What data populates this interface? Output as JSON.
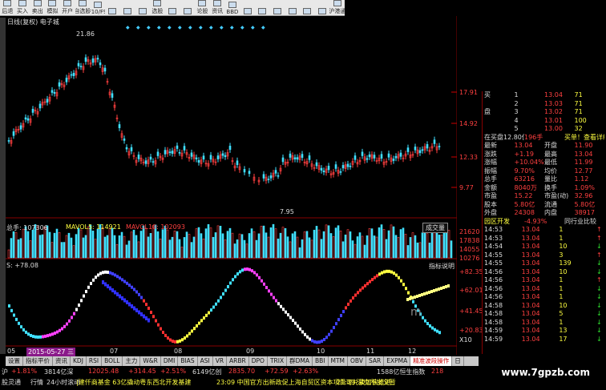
{
  "toolbar": [
    "后退",
    "买入",
    "卖出",
    "模拟",
    "开户",
    "自选股",
    "F10/F9",
    "",
    "",
    "",
    "选股",
    "",
    "",
    "论股",
    "资讯",
    "BBD",
    "",
    "",
    "",
    "",
    "",
    "",
    "沪港通"
  ],
  "chart_header": {
    "title": "日线(复权) 电子城"
  },
  "price_labels": {
    "high_mark": "21.86",
    "low_mark": "7.95",
    "ticks": [
      "17.91",
      "14.92",
      "12.33",
      "9.77"
    ]
  },
  "volume": {
    "label": "总手: 107306",
    "mavol5": "MAVOL5: 114921",
    "mavol10": "MAVOL10: 102093",
    "dropdown": "成交量",
    "ticks": [
      "21620",
      "17838",
      "14055",
      "10276"
    ]
  },
  "indicator": {
    "label": "S: +78.08",
    "button": "指标说明",
    "ticks": [
      "+82.35",
      "+62.01",
      "+41.45",
      "+20.83"
    ],
    "x10": "X10",
    "mark": "m"
  },
  "date_axis": {
    "labels": [
      "05",
      "07",
      "08",
      "09",
      "10",
      "11",
      "12"
    ],
    "cursor_date": "2015-05-27 三"
  },
  "quote": {
    "header_label": "买",
    "header_label2": "盘",
    "buy_rows": [
      {
        "lvl": "1",
        "price": "13.04",
        "vol": "71"
      },
      {
        "lvl": "2",
        "price": "13.03",
        "vol": "71"
      },
      {
        "lvl": "3",
        "price": "13.02",
        "vol": "71"
      },
      {
        "lvl": "4",
        "price": "13.01",
        "vol": "100"
      },
      {
        "lvl": "5",
        "price": "13.00",
        "vol": "32"
      }
    ],
    "banner": [
      "在买盘12.80位置有",
      "196手",
      "买单！查看详细"
    ],
    "stats": [
      {
        "k1": "最新",
        "v1": "13.04",
        "k2": "开盘",
        "v2": "11.90"
      },
      {
        "k1": "涨跌",
        "v1": "+1.19",
        "k2": "最高",
        "v2": "13.04"
      },
      {
        "k1": "涨幅",
        "v1": "+10.04%",
        "k2": "最低",
        "v2": "11.99"
      },
      {
        "k1": "振幅",
        "v1": "9.70%",
        "k2": "均价",
        "v2": "12.77"
      },
      {
        "k1": "总手",
        "v1": "63216",
        "k2": "量比",
        "v2": "1.12"
      },
      {
        "k1": "金额",
        "v1": "8040万",
        "k2": "换手",
        "v2": "1.09%"
      },
      {
        "k1": "市盈",
        "v1": "15.22",
        "k2": "市盈(动)",
        "v2": "32.96"
      },
      {
        "k1": "股本",
        "v1": "5.80亿",
        "k2": "流通",
        "v2": "5.80亿"
      },
      {
        "k1": "外盘",
        "v1": "24308",
        "k2": "内盘",
        "v2": "38917"
      }
    ],
    "sector": {
      "name": "园区开发",
      "pct": "-4.93%",
      "right": "同行业比较"
    },
    "ticks": [
      {
        "t": "14:53",
        "p": "13.04",
        "v": "1",
        "d": "up"
      },
      {
        "t": "14:53",
        "p": "13.04",
        "v": "1",
        "d": "up"
      },
      {
        "t": "14:54",
        "p": "13.04",
        "v": "10",
        "d": "dn"
      },
      {
        "t": "14:55",
        "p": "13.04",
        "v": "3",
        "d": "up"
      },
      {
        "t": "14:55",
        "p": "13.04",
        "v": "139",
        "d": "dn"
      },
      {
        "t": "14:56",
        "p": "13.04",
        "v": "10",
        "d": "dn"
      },
      {
        "t": "14:56",
        "p": "13.04",
        "v": "1",
        "d": "up"
      },
      {
        "t": "14:56",
        "p": "13.04",
        "v": "1",
        "d": "dn"
      },
      {
        "t": "14:56",
        "p": "13.04",
        "v": "1",
        "d": "dn"
      },
      {
        "t": "14:58",
        "p": "13.04",
        "v": "10",
        "d": "dn"
      },
      {
        "t": "14:58",
        "p": "13.04",
        "v": "5",
        "d": "dn"
      },
      {
        "t": "14:58",
        "p": "13.04",
        "v": "1",
        "d": "dn"
      },
      {
        "t": "14:59",
        "p": "13.04",
        "v": "13",
        "d": "dn"
      },
      {
        "t": "14:59",
        "p": "13.04",
        "v": "17",
        "d": "dn"
      }
    ]
  },
  "bottom_tabs": [
    "设置",
    "指标平价",
    "资讯",
    "KDJ",
    "RSI",
    "BOLL",
    "主力",
    "W&R",
    "DMI",
    "BIAS",
    "ASI",
    "VR",
    "ARBR",
    "DPO",
    "TRIX",
    "群DMA",
    "BBI",
    "MTM",
    "OBV",
    "SAR",
    "EXPMA",
    "精准波段操作",
    "日"
  ],
  "status": {
    "row1": [
      {
        "t": "沪",
        "c": "wh"
      },
      {
        "t": "+1.81%",
        "c": "up"
      },
      {
        "t": "3814亿深",
        "c": "wh"
      },
      {
        "t": "12025.48",
        "c": "up"
      },
      {
        "t": "+314.45",
        "c": "up"
      },
      {
        "t": "+2.51%",
        "c": "up"
      },
      {
        "t": "6149亿创",
        "c": "wh"
      },
      {
        "t": "2835.70",
        "c": "up"
      },
      {
        "t": "+72.59",
        "c": "up"
      },
      {
        "t": "+2.63%",
        "c": "up"
      },
      {
        "t": "1588亿恒生指数",
        "c": "wh"
      },
      {
        "t": "218",
        "c": "up"
      }
    ],
    "row2": [
      {
        "t": "股灵通",
        "c": "wh"
      },
      {
        "t": "行情",
        "c": "wh"
      },
      {
        "t": "24小时滚动",
        "c": "wh"
      },
      {
        "t": "|建仟商基金 63亿撬动粤东西北开发基建",
        "c": "yl"
      },
      {
        "t": "23:09 中国官方出新政促上海自贸区资本项目可兑换加快推进",
        "c": "yl"
      },
      {
        "t": "21:39 深交所发文暂",
        "c": "yl"
      }
    ]
  },
  "watermark": "www.7gpzb.com"
}
